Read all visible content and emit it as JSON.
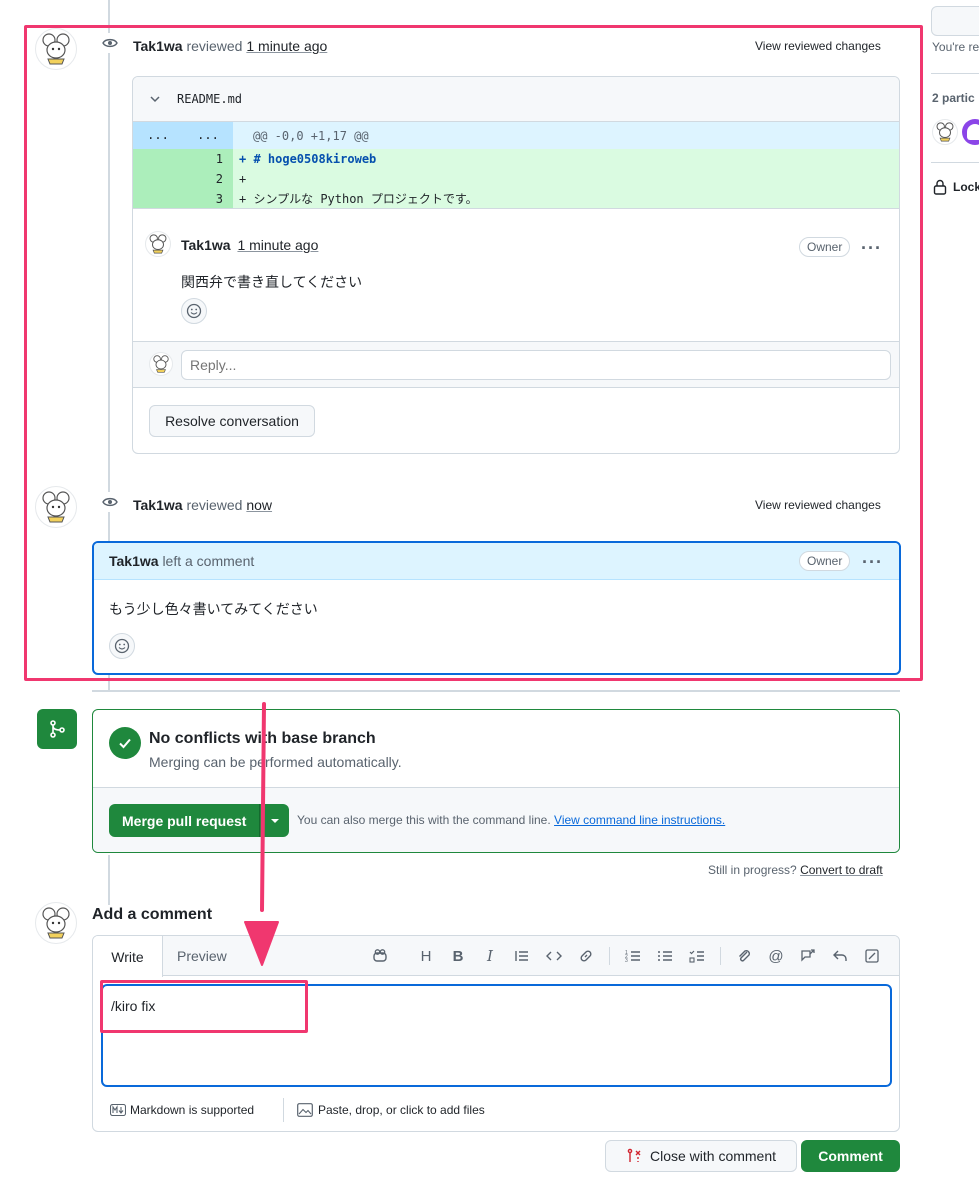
{
  "review1": {
    "author": "Tak1wa",
    "action": "reviewed",
    "time": "1 minute ago",
    "view_changes": "View reviewed changes",
    "file": {
      "name": "README.md",
      "hunk_header": "@@ -0,0 +1,17 @@",
      "hunk_old": "...",
      "hunk_new": "...",
      "lines": [
        {
          "num": "1",
          "code": "+ # hoge0508kiroweb"
        },
        {
          "num": "2",
          "code": "+"
        },
        {
          "num": "3",
          "code": "+ シンプルな Python プロジェクトです。"
        }
      ]
    },
    "comment": {
      "author": "Tak1wa",
      "time": "1 minute ago",
      "badge": "Owner",
      "more": "···",
      "body": "関西弁で書き直してください"
    },
    "reply_placeholder": "Reply...",
    "resolve_label": "Resolve conversation"
  },
  "review2": {
    "author": "Tak1wa",
    "action": "reviewed",
    "time": "now",
    "view_changes": "View reviewed changes",
    "comment": {
      "author": "Tak1wa",
      "action": "left a comment",
      "badge": "Owner",
      "more": "···",
      "body": "もう少し色々書いてみてください"
    }
  },
  "merge": {
    "title": "No conflicts with base branch",
    "subtitle": "Merging can be performed automatically.",
    "button": "Merge pull request",
    "also_text": "You can also merge this with the command line.",
    "instructions_link": "View command line instructions."
  },
  "draft": {
    "text": "Still in progress?",
    "link": "Convert to draft"
  },
  "add_comment": {
    "heading": "Add a comment",
    "tab_write": "Write",
    "tab_preview": "Preview",
    "textarea_value": "/kiro fix",
    "markdown_note": "Markdown is supported",
    "files_note": "Paste, drop, or click to add files",
    "close_button": "Close with comment",
    "comment_button": "Comment"
  },
  "sidebar": {
    "reviewing_text": "You're re",
    "participants": "2 partic",
    "lock_text": "Lock"
  },
  "colors": {
    "highlight": "#f0376f",
    "green": "#1f883d",
    "blue_border": "#0969da",
    "added_line_bg": "#dafbe1",
    "added_num_bg": "#aceebb",
    "hunk_bg": "#ddf4ff"
  }
}
